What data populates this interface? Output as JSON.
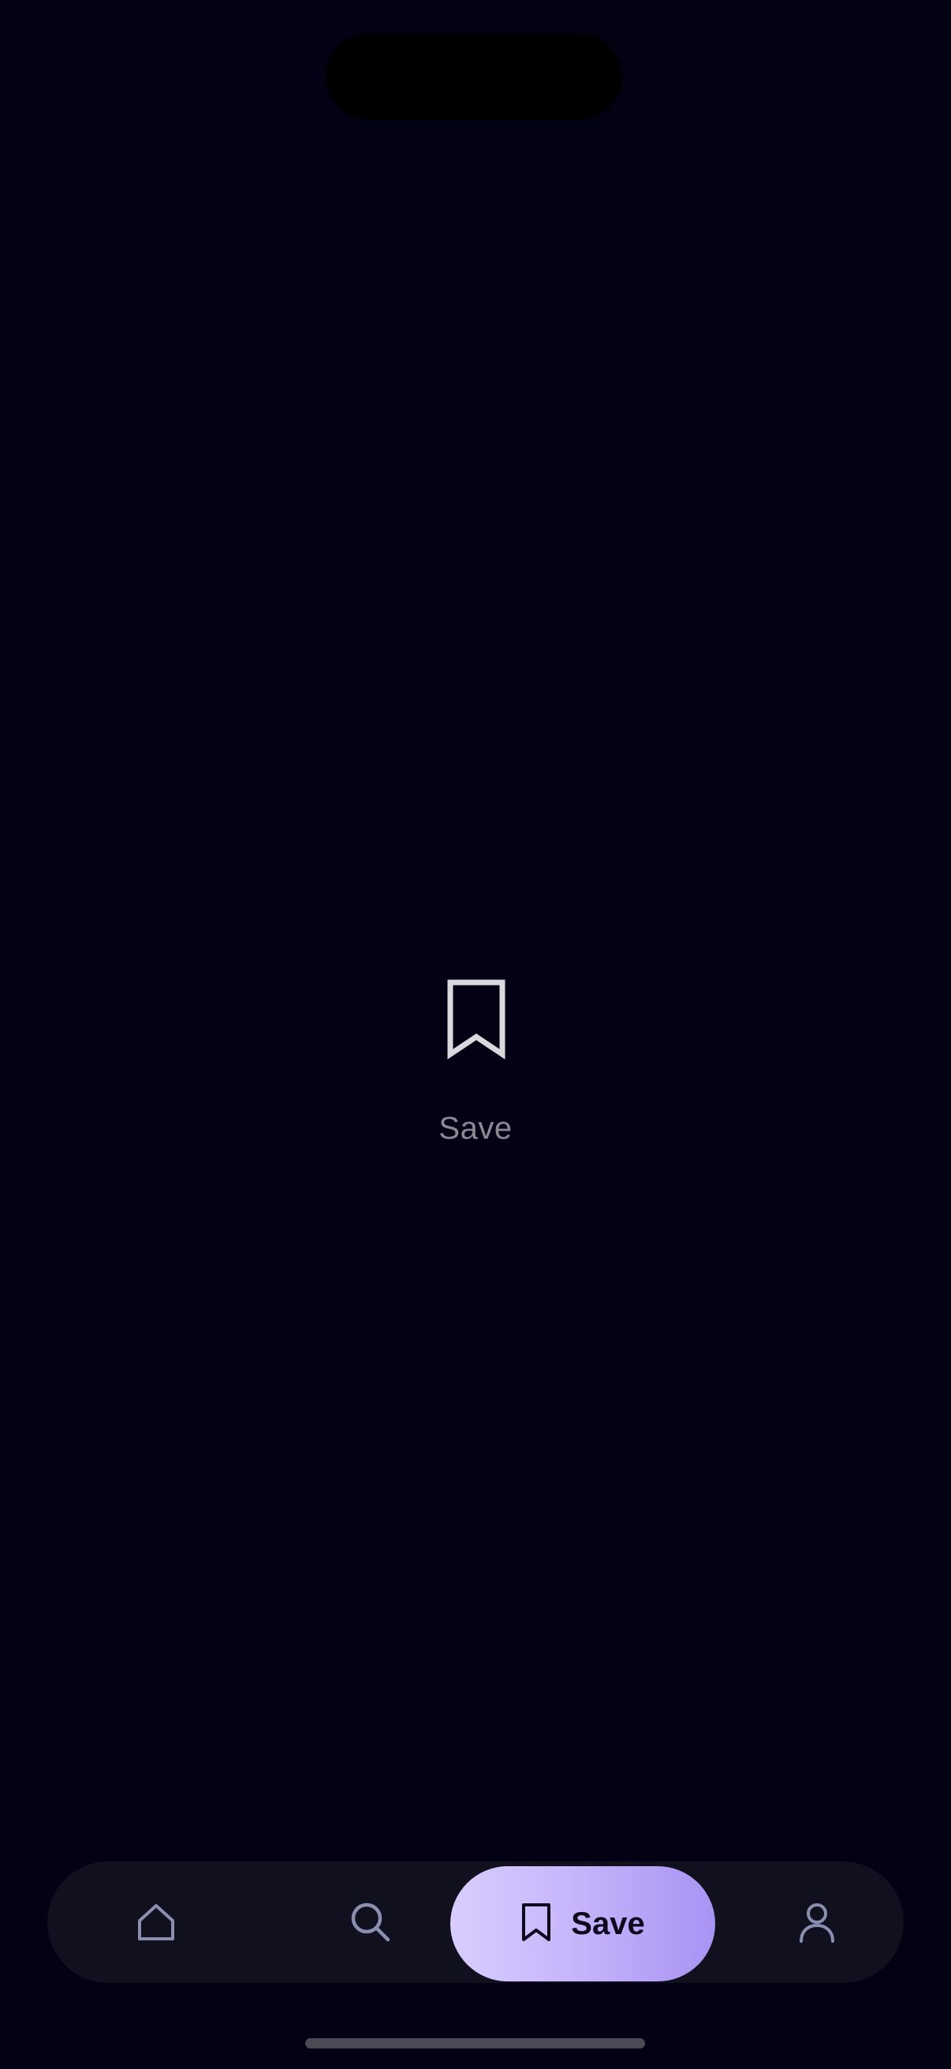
{
  "empty_state": {
    "icon": "bookmark-icon",
    "label": "Save"
  },
  "tab_bar": {
    "items": [
      {
        "id": "home",
        "icon": "home-icon",
        "label": ""
      },
      {
        "id": "search",
        "icon": "search-icon",
        "label": ""
      },
      {
        "id": "save",
        "icon": "bookmark-icon",
        "label": "Save",
        "active": true
      },
      {
        "id": "profile",
        "icon": "profile-icon",
        "label": ""
      }
    ]
  },
  "colors": {
    "background": "#030214",
    "tab_bar": "#11101f",
    "active_tab_gradient_start": "#d8cdfd",
    "active_tab_gradient_end": "#a893f3",
    "inactive_icon": "#8a8fb0",
    "muted_text": "#8a8a97"
  }
}
